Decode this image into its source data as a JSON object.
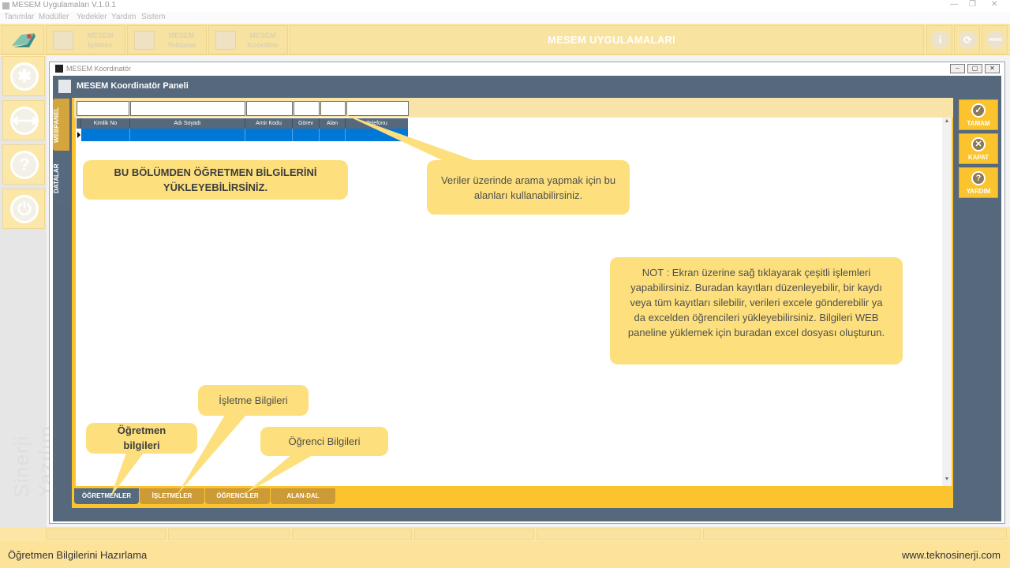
{
  "titlebar": {
    "title": "MESEM Uygulamaları V.1.0.1",
    "minimize": "—",
    "maximize": "❐",
    "close": "✕"
  },
  "menu": {
    "items": [
      "Tanımlar",
      "Modüller",
      "Yedekler",
      "Yardım",
      "Sistem"
    ]
  },
  "toolbar": {
    "app_title": "MESEM UYGULAMALARI",
    "modules": [
      {
        "line1": "MESEM",
        "line2": "İşletme"
      },
      {
        "line1": "MESEM",
        "line2": "Yoklama"
      },
      {
        "line1": "MESEM",
        "line2": "Koordine"
      }
    ],
    "right_icons": [
      "info-icon",
      "refresh-icon",
      "web-icon"
    ],
    "right_glyphs": [
      "i",
      "⟳",
      "www"
    ]
  },
  "sidebar": {
    "buttons": [
      "settings-icon",
      "swap-arrows-icon",
      "help-icon",
      "power-icon"
    ],
    "glyphs": [
      "✱",
      "⟷",
      "?",
      "⏻"
    ],
    "watermark": "Sinerji Yazılım"
  },
  "window": {
    "title": "MESEM Koordinatör",
    "panel_title": "MESEM Koordinatör Paneli",
    "vertical_tabs": [
      "WEBPANEL",
      "DATALAR"
    ],
    "grid": {
      "columns": [
        "Kimlik No",
        "Adı Soyadı",
        "Amir Kodu",
        "Görev",
        "Alan",
        "Telefonu"
      ]
    },
    "bottom_tabs": [
      "ÖĞRETMENLER",
      "İŞLETMELER",
      "ÖĞRENCİLER",
      "ALAN-DAL"
    ],
    "actions": [
      {
        "label": "TAMAM",
        "glyph": "✓"
      },
      {
        "label": "KAPAT",
        "glyph": "✕"
      },
      {
        "label": "YARDIM",
        "glyph": "?"
      }
    ]
  },
  "callouts": {
    "upload": "BU BÖLÜMDEN ÖĞRETMEN BİLGİLERİNİ YÜKLEYEBİLİRSİNİZ.",
    "search": "Veriler üzerinde arama yapmak için bu alanları kullanabilirsiniz.",
    "note": "NOT : Ekran üzerine sağ tıklayarak çeşitli işlemleri yapabilirsiniz. Buradan kayıtları düzenleyebilir, bir kaydı veya tüm kayıtları silebilir, verileri excele gönderebilir ya da excelden öğrencileri yükleyebilirsiniz. Bilgileri WEB paneline yüklemek için buradan excel dosyası oluşturun.",
    "ogretmen": "Öğretmen bilgileri",
    "isletme": "İşletme Bilgileri",
    "ogrenci": "Öğrenci Bilgileri"
  },
  "footer": {
    "caption": "Öğretmen Bilgilerini Hazırlama",
    "website": "www.teknosinerji.com"
  },
  "colors": {
    "accent_yellow": "#fbc42f",
    "panel_slate": "#56687c",
    "selection_blue": "#0078d7",
    "callout": "#fde07d"
  }
}
